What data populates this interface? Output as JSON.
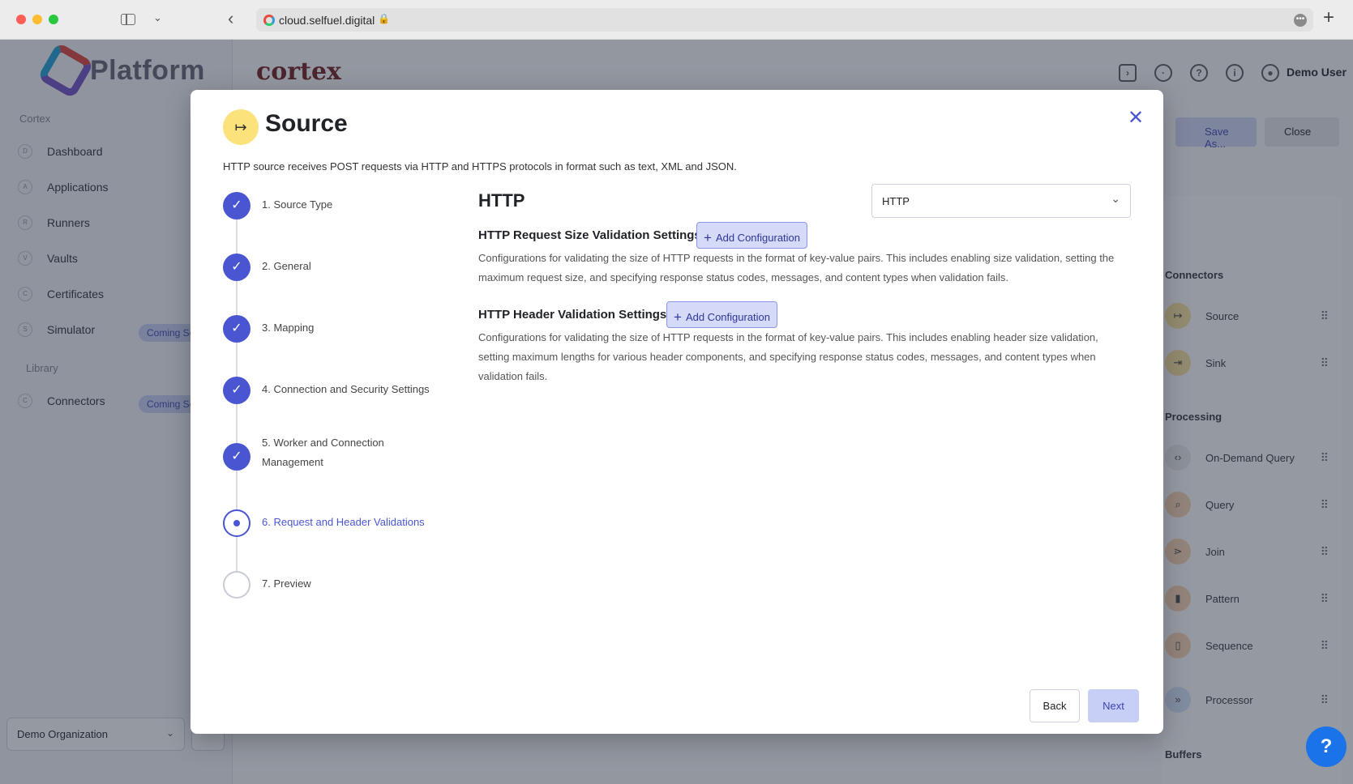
{
  "browser": {
    "url": "cloud.selfuel.digital"
  },
  "app": {
    "logo_text": "Platform",
    "cortex_logo": "cortex",
    "user_name": "Demo User",
    "nav_section_cortex": "Cortex",
    "nav_section_library": "Library",
    "nav_items": [
      {
        "badge": "D",
        "label": "Dashboard"
      },
      {
        "badge": "A",
        "label": "Applications"
      },
      {
        "badge": "R",
        "label": "Runners"
      },
      {
        "badge": "V",
        "label": "Vaults"
      },
      {
        "badge": "C",
        "label": "Certificates"
      },
      {
        "badge": "S",
        "label": "Simulator",
        "tag": "Coming Soon"
      },
      {
        "badge": "C",
        "label": "Connectors",
        "tag": "Coming Soon"
      }
    ],
    "org_select": "Demo Organization",
    "save_as": "Save As...",
    "close": "Close",
    "right_panel": {
      "connectors": "Connectors",
      "processing": "Processing",
      "buffers": "Buffers",
      "items": [
        "Source",
        "Sink",
        "On-Demand Query",
        "Query",
        "Join",
        "Pattern",
        "Sequence",
        "Processor"
      ]
    },
    "help": "?"
  },
  "modal": {
    "title": "Source",
    "description": "HTTP source receives POST requests via HTTP and HTTPS protocols in format such as text, XML and JSON.",
    "steps": [
      {
        "label": "1. Source Type",
        "state": "done"
      },
      {
        "label": "2. General",
        "state": "done"
      },
      {
        "label": "3. Mapping",
        "state": "done"
      },
      {
        "label": "4. Connection and Security Settings",
        "state": "done"
      },
      {
        "label": "5. Worker and Connection Management",
        "state": "done"
      },
      {
        "label": "6. Request and Header Validations",
        "state": "current"
      },
      {
        "label": "7. Preview",
        "state": "pending"
      }
    ],
    "content": {
      "title": "HTTP",
      "select_value": "HTTP",
      "section1": {
        "title": "HTTP Request Size Validation Settings",
        "button": "Add Configuration",
        "desc": "Configurations for validating the size of HTTP requests in the format of key-value pairs. This includes enabling size validation, setting the maximum request size, and specifying response status codes, messages, and content types when validation fails."
      },
      "section2": {
        "title": "HTTP Header Validation Settings",
        "button": "Add Configuration",
        "desc": "Configurations for validating the size of HTTP requests in the format of key-value pairs. This includes enabling header size validation, setting maximum lengths for various header components, and specifying response status codes, messages, and content types when validation fails."
      }
    },
    "back": "Back",
    "next": "Next"
  },
  "colors": {
    "accent": "#4a56d1",
    "source_icon_bg": "#fbe27a"
  }
}
